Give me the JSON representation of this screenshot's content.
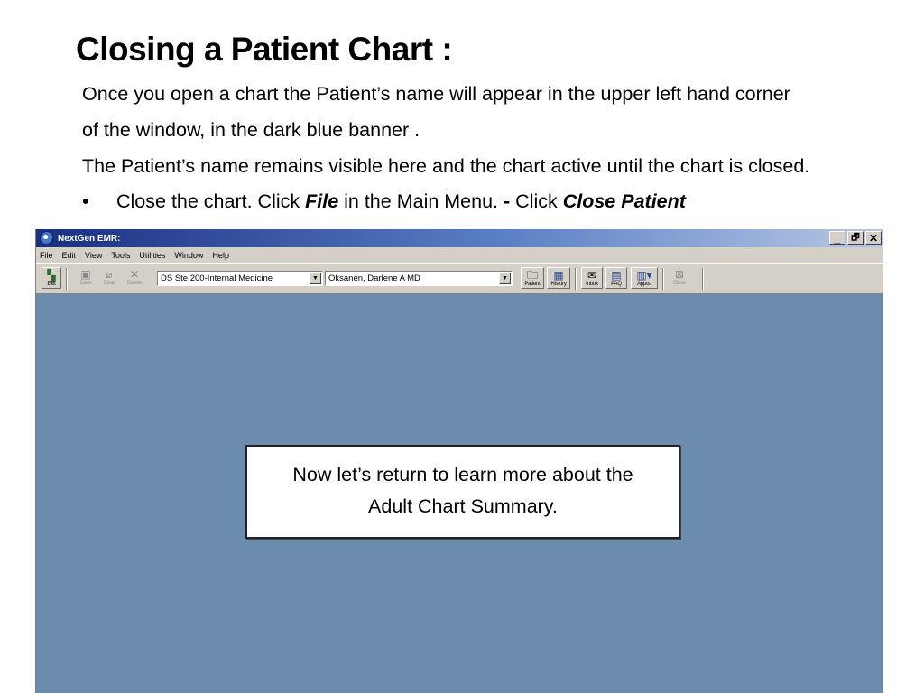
{
  "slide": {
    "title": "Closing a Patient Chart :",
    "lines": [
      "Once you open a chart the Patient’s name will appear in the upper left hand corner",
      "of the window, in the dark blue banner .",
      "The Patient’s name remains visible here and the chart active until the chart is closed."
    ],
    "bullet": {
      "marker": "•",
      "text1": "Close the chart.  Click  ",
      "file": "File",
      "text2": "  in the Main Menu.  ",
      "dash": "-",
      "text3": " Click ",
      "close_patient": "Close Patient"
    }
  },
  "app": {
    "title": "NextGen EMR:",
    "controls": [
      "_",
      "🗗",
      "✕"
    ],
    "menu": [
      "File",
      "Edit",
      "View",
      "Tools",
      "Utilities",
      "Window",
      "Help"
    ],
    "toolbar": {
      "exit": "Exit",
      "save": "Save",
      "clear": "Clear",
      "delete": "Delete",
      "location": "DS Ste 200-Internal Medicine",
      "provider": "Oksanen, Darlene  A MD",
      "patient": "Patient",
      "history": "History",
      "inbox": "Inbox",
      "pag": "PAQ",
      "appts": "Appts.",
      "close": "Close"
    }
  },
  "note": {
    "line1": "Now let’s return to learn more about the",
    "line2": "Adult Chart Summary."
  },
  "colors": {
    "workspace": "#6b8cac",
    "titlebar_start": "#1a2f82",
    "titlebar_end": "#b8c8e4",
    "chrome": "#d4d0c8"
  }
}
